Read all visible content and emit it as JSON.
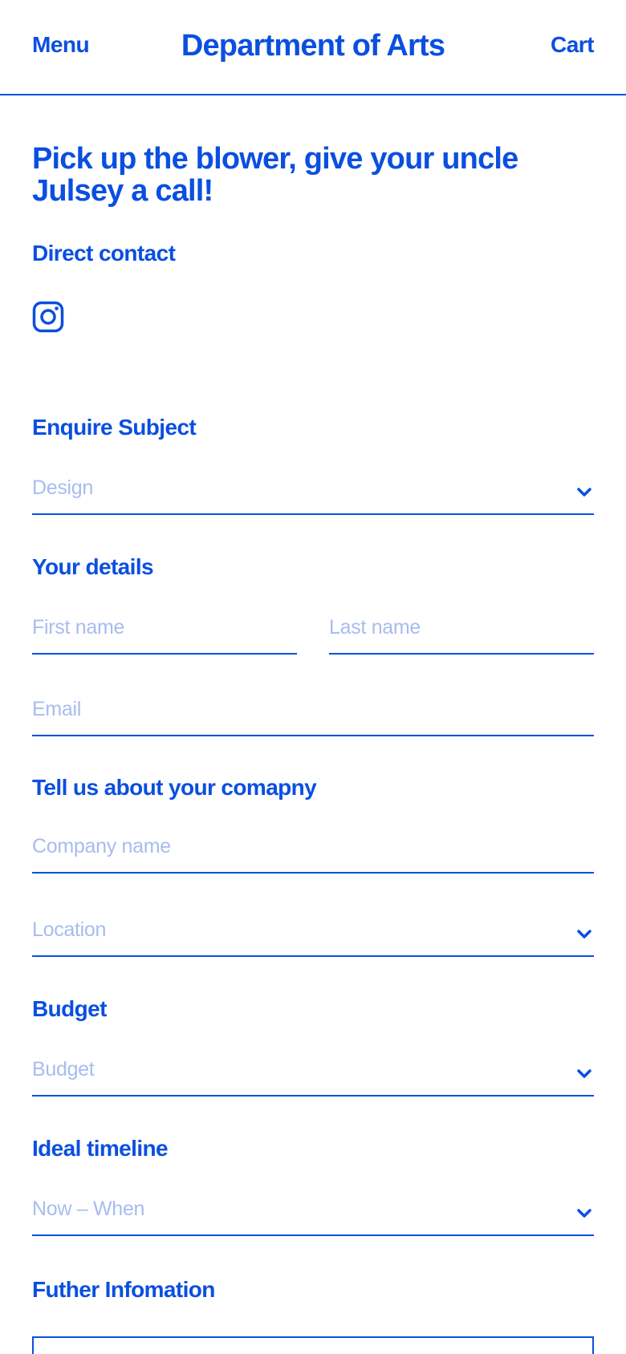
{
  "header": {
    "menu_label": "Menu",
    "title": "Department of Arts",
    "cart_label": "Cart"
  },
  "headline": "Pick up the blower, give your uncle Julsey a call!",
  "direct_contact": {
    "heading": "Direct contact",
    "icon": "instagram-icon"
  },
  "enquire": {
    "heading": "Enquire Subject",
    "select_value": "Design"
  },
  "details": {
    "heading": "Your details",
    "first_name_placeholder": "First name",
    "last_name_placeholder": "Last name",
    "email_placeholder": "Email"
  },
  "company": {
    "heading": "Tell us about your comapny",
    "company_name_placeholder": "Company name",
    "location_value": "Location"
  },
  "budget": {
    "heading": "Budget",
    "select_value": "Budget"
  },
  "timeline": {
    "heading": "Ideal timeline",
    "select_value": "Now – When"
  },
  "further": {
    "heading": "Futher Infomation"
  },
  "colors": {
    "accent": "#0a4fe0",
    "placeholder": "#a7bcef",
    "background": "#ffffff"
  }
}
